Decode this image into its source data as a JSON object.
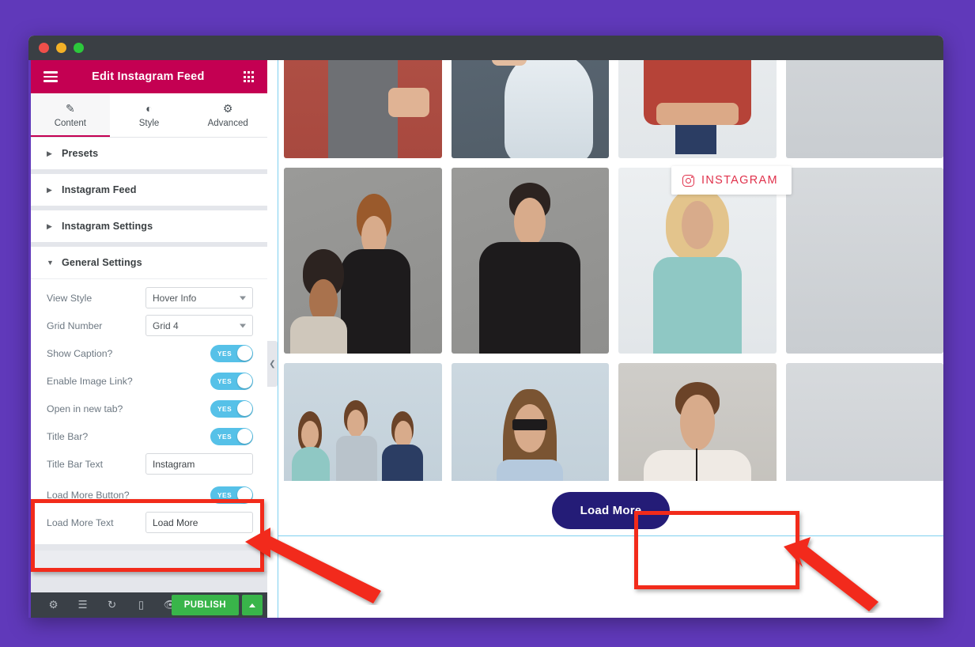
{
  "window": {
    "controls": [
      "close",
      "minimize",
      "maximize"
    ]
  },
  "panel": {
    "title": "Edit Instagram Feed",
    "menu_icon": "hamburger-icon",
    "apps_icon": "grid-apps-icon",
    "tabs": [
      {
        "id": "content",
        "label": "Content",
        "icon": "pencil-icon",
        "active": true
      },
      {
        "id": "style",
        "label": "Style",
        "icon": "contrast-icon",
        "active": false
      },
      {
        "id": "advanced",
        "label": "Advanced",
        "icon": "gear-icon",
        "active": false
      }
    ],
    "sections": [
      {
        "id": "presets",
        "label": "Presets",
        "expanded": false
      },
      {
        "id": "instagram-feed",
        "label": "Instagram Feed",
        "expanded": false
      },
      {
        "id": "instagram-settings",
        "label": "Instagram Settings",
        "expanded": false
      },
      {
        "id": "general-settings",
        "label": "General Settings",
        "expanded": true
      }
    ],
    "general_settings": {
      "view_style": {
        "label": "View Style",
        "value": "Hover Info",
        "type": "select"
      },
      "grid_number": {
        "label": "Grid Number",
        "value": "Grid 4",
        "type": "select"
      },
      "show_caption": {
        "label": "Show Caption?",
        "value": "YES",
        "type": "toggle"
      },
      "enable_image_link": {
        "label": "Enable Image Link?",
        "value": "YES",
        "type": "toggle"
      },
      "open_in_new_tab": {
        "label": "Open in new tab?",
        "value": "YES",
        "type": "toggle"
      },
      "title_bar": {
        "label": "Title Bar?",
        "value": "YES",
        "type": "toggle"
      },
      "title_bar_text": {
        "label": "Title Bar Text",
        "value": "Instagram",
        "type": "text"
      },
      "load_more_button": {
        "label": "Load More Button?",
        "value": "YES",
        "type": "toggle"
      },
      "load_more_text": {
        "label": "Load More Text",
        "value": "Load More",
        "type": "text"
      }
    },
    "footer": {
      "tools": [
        {
          "id": "settings",
          "icon": "gear-icon"
        },
        {
          "id": "navigator",
          "icon": "layers-icon"
        },
        {
          "id": "history",
          "icon": "history-clock-icon"
        },
        {
          "id": "responsive",
          "icon": "monitor-icon"
        },
        {
          "id": "preview",
          "icon": "eye-icon"
        }
      ],
      "publish_label": "PUBLISH",
      "publish_caret_icon": "chevron-up-icon"
    }
  },
  "canvas": {
    "collapse_icon": "chevron-left-icon",
    "hover_badge": {
      "label": "INSTAGRAM",
      "icon": "instagram-camera-icon"
    },
    "load_more_button_label": "Load More",
    "grid_columns": 4,
    "photos": [
      {
        "id": "photo-1",
        "alt": "woman in grey dress against red wall"
      },
      {
        "id": "photo-2",
        "alt": "woman in silver gown"
      },
      {
        "id": "photo-3",
        "alt": "man in plaid shirt arms crossed"
      },
      {
        "id": "photo-4",
        "alt": "partially visible photo"
      },
      {
        "id": "photo-5",
        "alt": "two women working together"
      },
      {
        "id": "photo-6",
        "alt": "man in black sweater"
      },
      {
        "id": "photo-7",
        "alt": "blonde woman in floral dress"
      },
      {
        "id": "photo-8",
        "alt": "partially visible photo"
      },
      {
        "id": "photo-9",
        "alt": "three colleagues with laptops"
      },
      {
        "id": "photo-10",
        "alt": "woman with glasses holding red book"
      },
      {
        "id": "photo-11",
        "alt": "man with necklace in cream sweater"
      },
      {
        "id": "photo-12",
        "alt": "partially visible photo"
      }
    ]
  },
  "annotations": {
    "panel_highlight": "red-box-around-load-more-settings",
    "canvas_highlight": "red-box-around-load-more-button",
    "arrow_left": "red-arrow-pointing-to-load-more-settings",
    "arrow_right": "red-arrow-pointing-to-load-more-button"
  },
  "colors": {
    "background_purple": "#6039ba",
    "panel_header_pink": "#c40052",
    "toggle_blue": "#56c1e8",
    "publish_green": "#39b54a",
    "load_more_navy": "#241c77",
    "instagram_red": "#e0314b",
    "annotation_red": "#f22b1b"
  }
}
